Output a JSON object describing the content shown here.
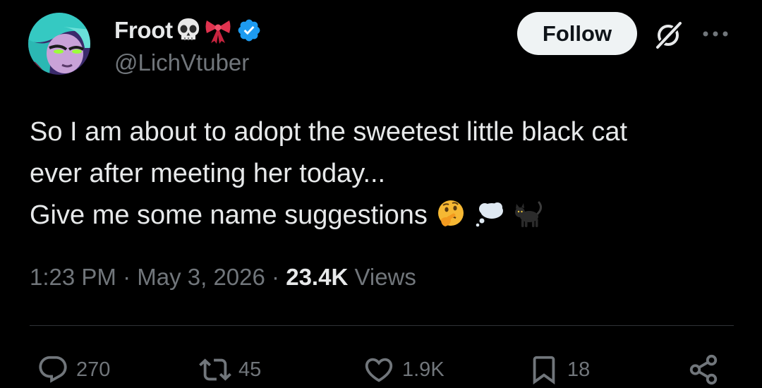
{
  "author": {
    "display_name": "Froot",
    "name_emojis": [
      "skull-emoji",
      "ribbon-emoji"
    ],
    "verified": true,
    "handle": "@LichVtuber"
  },
  "header": {
    "follow_label": "Follow"
  },
  "tweet": {
    "lines": [
      "So I am about to adopt the sweetest little black cat",
      "ever after meeting her today...",
      "Give me some name suggestions"
    ],
    "trailing_emojis": [
      "thinking-face-emoji",
      "thought-balloon-emoji",
      "black-cat-emoji"
    ]
  },
  "meta": {
    "time": "1:23 PM",
    "separator": "·",
    "date": "May 3, 2026",
    "views_count": "23.4K",
    "views_label": "Views"
  },
  "actions": {
    "replies": "270",
    "reposts": "45",
    "likes": "1.9K",
    "bookmarks": "18"
  },
  "colors": {
    "background": "#000000",
    "primary_text": "#e7e9ea",
    "secondary_text": "#71767b",
    "verified": "#1d9bf0",
    "follow_bg": "#eff3f4",
    "divider": "#2f3336"
  }
}
